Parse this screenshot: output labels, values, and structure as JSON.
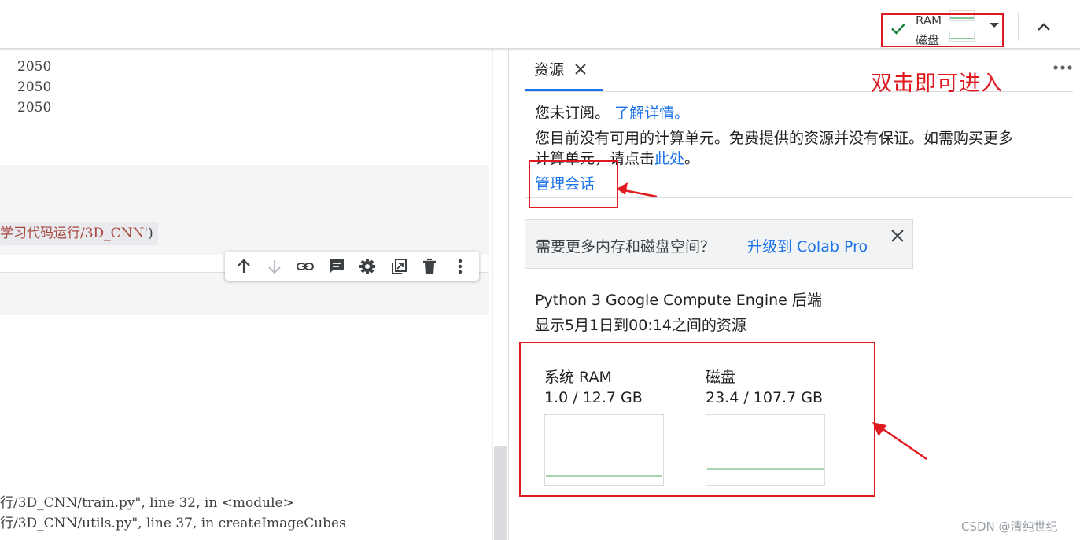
{
  "topbar": {
    "resources": {
      "ram_label": "RAM",
      "disk_label": "磁盘",
      "status_icon": "check-icon",
      "dropdown_icon": "caret-down-icon"
    },
    "collapse_icon": "chevron-up-icon"
  },
  "annotation": {
    "text": "双击即可进入",
    "color": "#e0191f"
  },
  "notebook": {
    "output_lines": [
      "2050",
      "2050",
      "2050"
    ],
    "code_snippet": "学习代码运行/3D_CNN'",
    "code_snippet_close": ")",
    "cell_toolbar": [
      "arrow-up-icon",
      "arrow-down-icon",
      "link-icon",
      "comment-icon",
      "gear-icon",
      "mirror-cell-icon",
      "delete-icon",
      "more-vert-icon"
    ],
    "traceback": [
      "行/3D_CNN/train.py\", line 32, in <module>",
      "行/3D_CNN/utils.py\", line 37, in createImageCubes"
    ]
  },
  "panel": {
    "tab_label": "资源",
    "subscription": {
      "text": "您未订阅。",
      "link": "了解详情。"
    },
    "compute_units": {
      "line1": "您目前没有可用的计算单元。免费提供的资源并没有保证。如需购买更多",
      "line2_prefix": "计算单元，请点击",
      "line2_link": "此处",
      "line2_suffix": "。"
    },
    "manage_sessions": "管理会话",
    "upgrade": {
      "text": "需要更多内存和磁盘空间？",
      "link": "升级到 Colab Pro"
    },
    "backend": "Python 3 Google Compute Engine 后端",
    "time_range": "显示5月1日到00:14之间的资源",
    "meters": [
      {
        "label": "系统 RAM",
        "value": "1.0 / 12.7 GB",
        "fraction": 0.079
      },
      {
        "label": "磁盘",
        "value": "23.4 / 107.7 GB",
        "fraction": 0.217
      }
    ]
  },
  "watermark": "CSDN @清纯世纪"
}
